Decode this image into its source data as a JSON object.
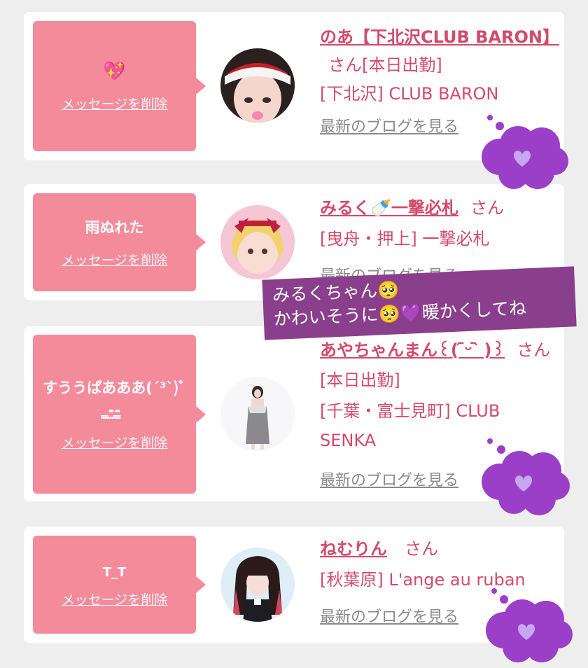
{
  "cards": [
    {
      "message": "💖",
      "delete_label": "メッセージを削除",
      "name": "のあ【下北沢CLUB BARON】",
      "san_label": "さん",
      "status": "[本日出勤]",
      "shop": "[下北沢] CLUB BARON",
      "blog_label": "最新のブログを見る"
    },
    {
      "message": "雨ぬれた",
      "delete_label": "メッセージを削除",
      "name": "みるく🍼一撃必札",
      "san_label": "さん",
      "status": "",
      "shop": "[曳舟・押上] 一撃必札",
      "blog_label": "最新のブログを見る"
    },
    {
      "message": "すううぱあああ(´³`)ﾞ ̳-̫-̳",
      "delete_label": "メッセージを削除",
      "name": "あやちゃんまん꒰( ᷇ᵕ ᷆ )꒱",
      "san_label": "さん",
      "status": "[本日出勤]",
      "shop": "[千葉・富士見町] CLUB SENKA",
      "blog_label": "最新のブログを見る"
    },
    {
      "message": "T_T",
      "delete_label": "メッセージを削除",
      "name": "ねむりん",
      "san_label": "さん",
      "status": "",
      "shop": "[秋葉原] L'ange au ruban",
      "blog_label": "最新のブログを見る"
    }
  ],
  "overlay": {
    "line1": "みるくちゃん🥺",
    "line2": "かわいそうに🥺💜暖かくしてね"
  },
  "colors": {
    "bubble": "#f48b9b",
    "accent": "#d44a6a",
    "cloud": "#9b3fc8",
    "overlay": "#8a3f8c"
  }
}
